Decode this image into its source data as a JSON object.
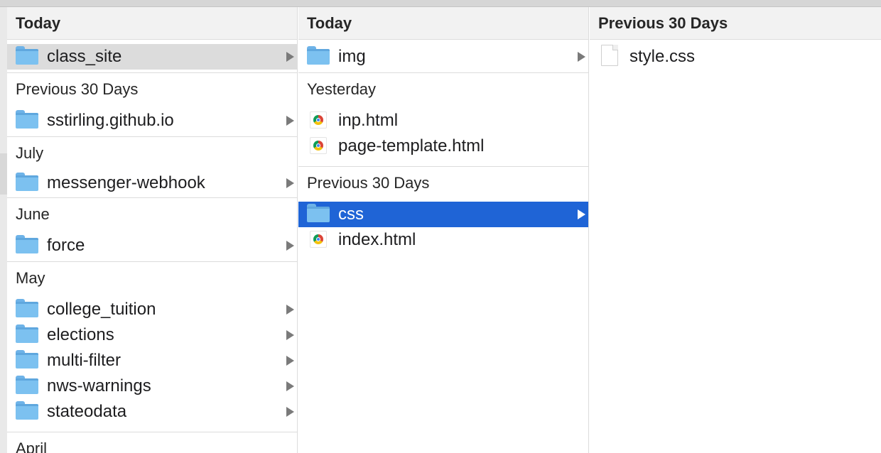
{
  "columns": [
    {
      "header": "Today",
      "items": [
        {
          "label": "class_site",
          "icon": "folder-icon",
          "chevron": true,
          "selected": "inactive"
        }
      ],
      "sections": [
        {
          "title": "Previous 30 Days",
          "items": [
            {
              "label": "sstirling.github.io",
              "icon": "folder-icon",
              "chevron": true
            }
          ]
        },
        {
          "title": "July",
          "items": [
            {
              "label": "messenger-webhook",
              "icon": "folder-icon",
              "chevron": true
            }
          ]
        },
        {
          "title": "June",
          "items": [
            {
              "label": "force",
              "icon": "folder-icon",
              "chevron": true
            }
          ]
        },
        {
          "title": "May",
          "items": [
            {
              "label": "college_tuition",
              "icon": "folder-icon",
              "chevron": true
            },
            {
              "label": "elections",
              "icon": "folder-icon",
              "chevron": true
            },
            {
              "label": "multi-filter",
              "icon": "folder-icon",
              "chevron": true
            },
            {
              "label": "nws-warnings",
              "icon": "folder-icon",
              "chevron": true
            },
            {
              "label": "stateodata",
              "icon": "folder-icon",
              "chevron": true
            }
          ]
        },
        {
          "title": "April",
          "items": []
        }
      ]
    },
    {
      "header": "Today",
      "items": [
        {
          "label": "img",
          "icon": "folder-icon",
          "chevron": true
        }
      ],
      "sections": [
        {
          "title": "Yesterday",
          "items": [
            {
              "label": "inp.html",
              "icon": "chrome-html-icon",
              "chevron": false
            },
            {
              "label": "page-template.html",
              "icon": "chrome-html-icon",
              "chevron": false
            }
          ]
        },
        {
          "title": "Previous 30 Days",
          "items": [
            {
              "label": "css",
              "icon": "folder-icon",
              "chevron": true,
              "selected": "active"
            },
            {
              "label": "index.html",
              "icon": "chrome-html-icon",
              "chevron": false
            }
          ]
        }
      ]
    },
    {
      "header": "Previous 30 Days",
      "items": [
        {
          "label": "style.css",
          "icon": "document-icon",
          "chevron": false
        }
      ]
    }
  ],
  "colors": {
    "selection_active": "#1f64d6",
    "selection_inactive": "#dcdcdc",
    "folder": "#7cc1f0"
  }
}
